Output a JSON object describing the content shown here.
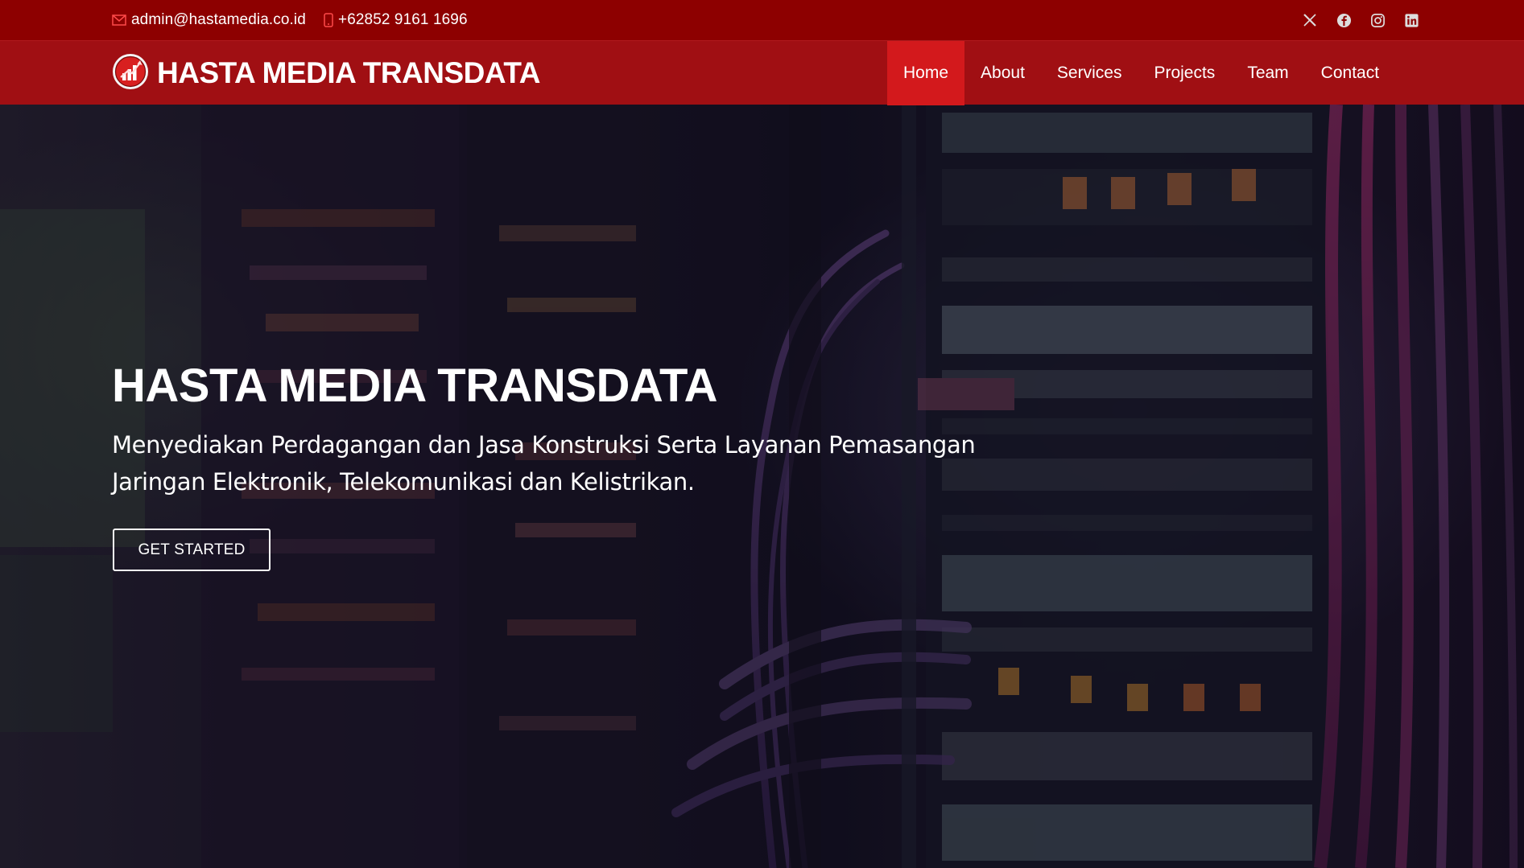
{
  "topbar": {
    "email": "admin@hastamedia.co.id",
    "phone": "+62852 9161 1696",
    "email_icon": "envelope-icon",
    "phone_icon": "phone-icon",
    "socials": [
      "x-twitter-icon",
      "facebook-icon",
      "instagram-icon",
      "linkedin-icon"
    ]
  },
  "navbar": {
    "brand": "HASTA MEDIA TRANSDATA",
    "brand_icon": "bar-chart-logo-icon",
    "items": [
      {
        "label": "Home",
        "active": true
      },
      {
        "label": "About",
        "active": false
      },
      {
        "label": "Services",
        "active": false
      },
      {
        "label": "Projects",
        "active": false
      },
      {
        "label": "Team",
        "active": false
      },
      {
        "label": "Contact",
        "active": false
      }
    ]
  },
  "hero": {
    "title": "HASTA MEDIA TRANSDATA",
    "subtitle": "Menyediakan Perdagangan dan Jasa Konstruksi Serta Layanan Pemasangan Jaringan Elektronik, Telekomunikasi dan Kelistrikan.",
    "cta": "GET STARTED"
  },
  "colors": {
    "topbar_bg": "#8d0000",
    "navbar_bg": "#a00f13",
    "active_item_bg": "#d3191c",
    "text": "#ffffff"
  }
}
